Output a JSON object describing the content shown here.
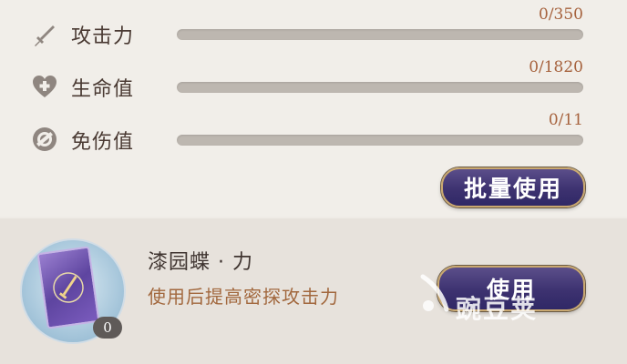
{
  "stats": [
    {
      "label": "攻击力",
      "value_text": "0/350",
      "current": 0,
      "max": 350,
      "icon": "sword-icon"
    },
    {
      "label": "生命值",
      "value_text": "0/1820",
      "current": 0,
      "max": 1820,
      "icon": "heart-plus-icon"
    },
    {
      "label": "免伤值",
      "value_text": "0/11",
      "current": 0,
      "max": 11,
      "icon": "shield-block-icon"
    }
  ],
  "batch_use_label": "批量使用",
  "item": {
    "name": "漆园蝶 · 力",
    "description": "使用后提高密探攻击力",
    "count": "0",
    "icon": "sword-card-icon"
  },
  "use_label": "使用",
  "watermark": "豌豆荚",
  "colors": {
    "accent": "#a6623d",
    "button": "#3d3270",
    "button_border": "#c9a870"
  }
}
